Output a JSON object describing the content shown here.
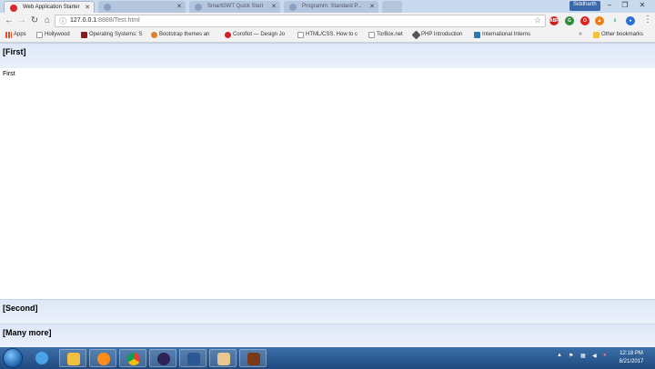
{
  "browser": {
    "tabs": [
      {
        "label": "Web Application Starter",
        "active": true
      },
      {
        "label": "",
        "active": false
      },
      {
        "label": "SmartGWT Quick Start",
        "active": false
      },
      {
        "label": "Programm: Standard P...",
        "active": false
      }
    ],
    "user_name": "Siddharth",
    "url_host": "127.0.0.1",
    "url_rest": ":8888/Test.html"
  },
  "bookmarks": [
    {
      "label": "Apps",
      "icon": "apps-grid-icon",
      "color": "#e0502a"
    },
    {
      "label": "Hollywood",
      "icon": "page-icon",
      "color": "#888888"
    },
    {
      "label": "Operating Systems: S",
      "icon": "m-logo-icon",
      "color": "#8b1a1a"
    },
    {
      "label": "Bootstrap themes an",
      "icon": "bootstrap-icon",
      "color": "#d9822b"
    },
    {
      "label": "Coroflot — Design Jo",
      "icon": "coroflot-icon",
      "color": "#d3202d"
    },
    {
      "label": "HTML/CSS. How to c",
      "icon": "page-icon",
      "color": "#888888"
    },
    {
      "label": "TorBox.net",
      "icon": "page-icon",
      "color": "#888888"
    },
    {
      "label": "PHP Introduction",
      "icon": "php-icon",
      "color": "#555555"
    },
    {
      "label": "International Interns",
      "icon": "is-logo-icon",
      "color": "#2a7ab8"
    }
  ],
  "other_bookmarks": "Other bookmarks",
  "page": {
    "sections": [
      {
        "title": "[First]"
      },
      {
        "title": "[Second]"
      },
      {
        "title": "[Many more]"
      }
    ],
    "first_content": "First"
  },
  "taskbar": {
    "time": "12:18 PM",
    "date": "8/21/2017"
  }
}
